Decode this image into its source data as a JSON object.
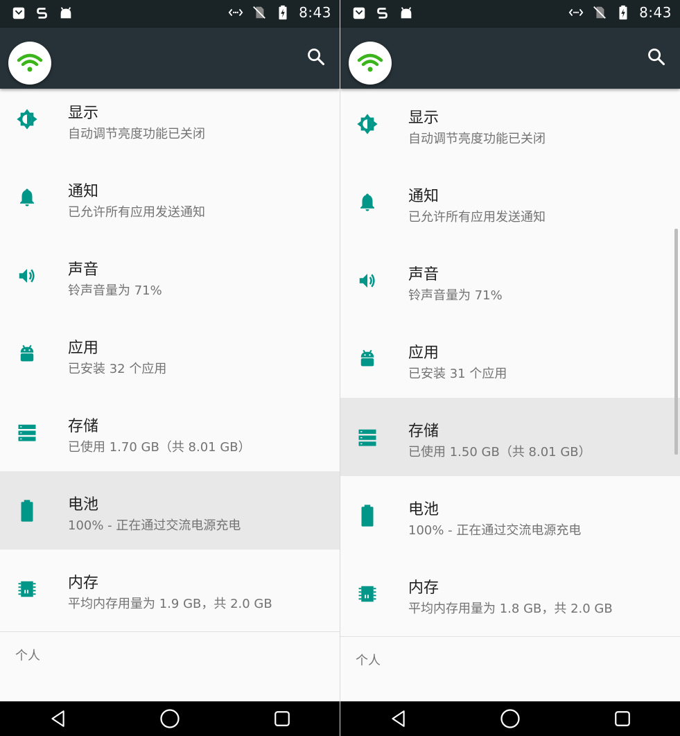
{
  "colors": {
    "toolbar": "#263238",
    "statusbar": "#1a2326",
    "accent": "#009688",
    "highlight": "#e8e8e8",
    "wifi": "#3bb51b"
  },
  "icons": [
    "mail-icon",
    "s-app-icon",
    "android-icon",
    "wifi-calling-icon",
    "no-sim-icon",
    "battery-charging-icon",
    "wifi-icon",
    "search-icon",
    "brightness-icon",
    "bell-icon",
    "volume-icon",
    "android-icon",
    "storage-icon",
    "battery-icon",
    "memory-icon",
    "back-icon",
    "home-icon",
    "recents-icon"
  ],
  "left": {
    "status": {
      "time": "8:43"
    },
    "items": [
      {
        "title": "显示",
        "sub": "自动调节亮度功能已关闭"
      },
      {
        "title": "通知",
        "sub": "已允许所有应用发送通知"
      },
      {
        "title": "声音",
        "sub": "铃声音量为 71%"
      },
      {
        "title": "应用",
        "sub": "已安装 32 个应用"
      },
      {
        "title": "存储",
        "sub": "已使用 1.70 GB（共 8.01 GB）"
      },
      {
        "title": "电池",
        "sub": "100% - 正在通过交流电源充电"
      },
      {
        "title": "内存",
        "sub": "平均内存用量为 1.9 GB，共 2.0 GB"
      }
    ],
    "section": "个人"
  },
  "right": {
    "status": {
      "time": "8:43"
    },
    "items": [
      {
        "title": "显示",
        "sub": "自动调节亮度功能已关闭"
      },
      {
        "title": "通知",
        "sub": "已允许所有应用发送通知"
      },
      {
        "title": "声音",
        "sub": "铃声音量为 71%"
      },
      {
        "title": "应用",
        "sub": "已安装 31 个应用"
      },
      {
        "title": "存储",
        "sub": "已使用 1.50 GB（共 8.01 GB）"
      },
      {
        "title": "电池",
        "sub": "100% - 正在通过交流电源充电"
      },
      {
        "title": "内存",
        "sub": "平均内存用量为 1.8 GB，共 2.0 GB"
      }
    ],
    "section": "个人"
  }
}
